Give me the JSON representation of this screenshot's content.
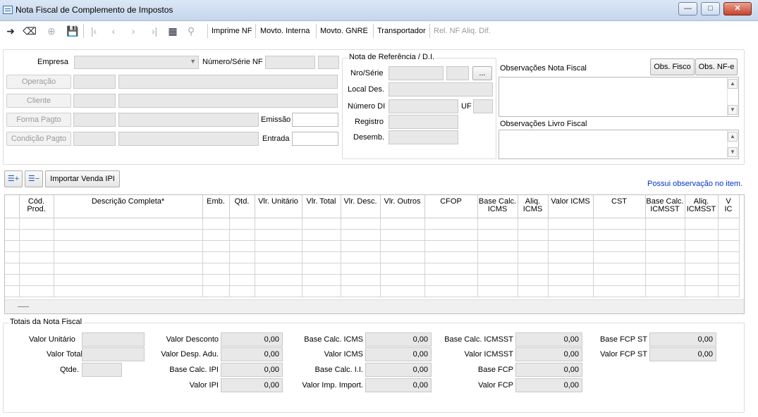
{
  "window": {
    "title": "Nota Fiscal de Complemento de Impostos"
  },
  "colors": {
    "note": "#0033cc",
    "disabled_text": "#9a9a9a",
    "field_bg": "#e8e8e8"
  },
  "toolbar": {
    "icons": [
      "exit-icon",
      "eraser-icon",
      "add-icon",
      "save-icon",
      "first-icon",
      "previous-icon",
      "next-icon",
      "last-icon",
      "table-icon",
      "search-icon"
    ],
    "imprime_nf": "Imprime NF",
    "movto_interna": "Movto. Interna",
    "movto_gnre": "Movto. GNRE",
    "transportador": "Transportador",
    "rel_nf": "Rel. NF Aliq. Dif."
  },
  "header": {
    "empresa_label": "Empresa",
    "numero_serie_label": "Número/Série NF",
    "operacao_button": "Operação",
    "cliente_button": "Cliente",
    "forma_pagto_button": "Forma Pagto",
    "condicao_pagto_button": "Condição Pagto",
    "emissao_label": "Emissão",
    "entrada_label": "Entrada"
  },
  "referencia": {
    "group_title": "Nota de Referência / D.I.",
    "nro_serie_label": "Nro/Série",
    "ellipsis": "...",
    "local_des_label": "Local Des.",
    "numero_di_label": "Número DI",
    "uf_label": "UF",
    "registro_label": "Registro",
    "desemb_label": "Desemb."
  },
  "observacoes": {
    "nota_label": "Observações Nota Fiscal",
    "obs_fisco_button": "Obs. Fisco",
    "obs_nfe_button": "Obs. NF-e",
    "livro_label": "Observações Livro Fiscal"
  },
  "items": {
    "importar_button": "Importar Venda IPI",
    "note": "Possui observação no item.",
    "columns": [
      [
        "",
        ""
      ],
      [
        "Cód.",
        "Prod."
      ],
      [
        "Descrição Completa*",
        ""
      ],
      [
        "Emb.",
        ""
      ],
      [
        "Qtd.",
        ""
      ],
      [
        "Vlr. Unitário",
        ""
      ],
      [
        "Vlr. Total",
        ""
      ],
      [
        "Vlr. Desc.",
        ""
      ],
      [
        "Vlr. Outros",
        ""
      ],
      [
        "CFOP",
        ""
      ],
      [
        "Base Calc.",
        "ICMS"
      ],
      [
        "Aliq.",
        "ICMS"
      ],
      [
        "Valor ICMS",
        ""
      ],
      [
        "CST",
        ""
      ],
      [
        "Base Calc.",
        "ICMSST"
      ],
      [
        "Aliq.",
        "ICMSST"
      ],
      [
        "V",
        "IC"
      ]
    ],
    "row_count": 7
  },
  "totais": {
    "group_title": "Totais da Nota Fiscal",
    "valor_unitario": "Valor Unitário",
    "valor_total": "Valor Total",
    "qtde": "Qtde.",
    "col2": [
      {
        "label": "Valor Desconto",
        "value": "0,00"
      },
      {
        "label": "Valor Desp. Adu.",
        "value": "0,00"
      },
      {
        "label": "Base Calc. IPI",
        "value": "0,00"
      },
      {
        "label": "Valor IPI",
        "value": "0,00"
      }
    ],
    "col3": [
      {
        "label": "Base Calc. ICMS",
        "value": "0,00"
      },
      {
        "label": "Valor ICMS",
        "value": "0,00"
      },
      {
        "label": "Base Calc. I.I.",
        "value": "0,00"
      },
      {
        "label": "Valor Imp. Import.",
        "value": "0,00"
      }
    ],
    "col4": [
      {
        "label": "Base Calc. ICMSST",
        "value": "0,00"
      },
      {
        "label": "Valor ICMSST",
        "value": "0,00"
      },
      {
        "label": "Base FCP",
        "value": "0,00"
      },
      {
        "label": "Valor FCP",
        "value": "0,00"
      }
    ],
    "col5": [
      {
        "label": "Base FCP ST",
        "value": "0,00"
      },
      {
        "label": "Valor FCP ST",
        "value": "0,00"
      }
    ]
  }
}
